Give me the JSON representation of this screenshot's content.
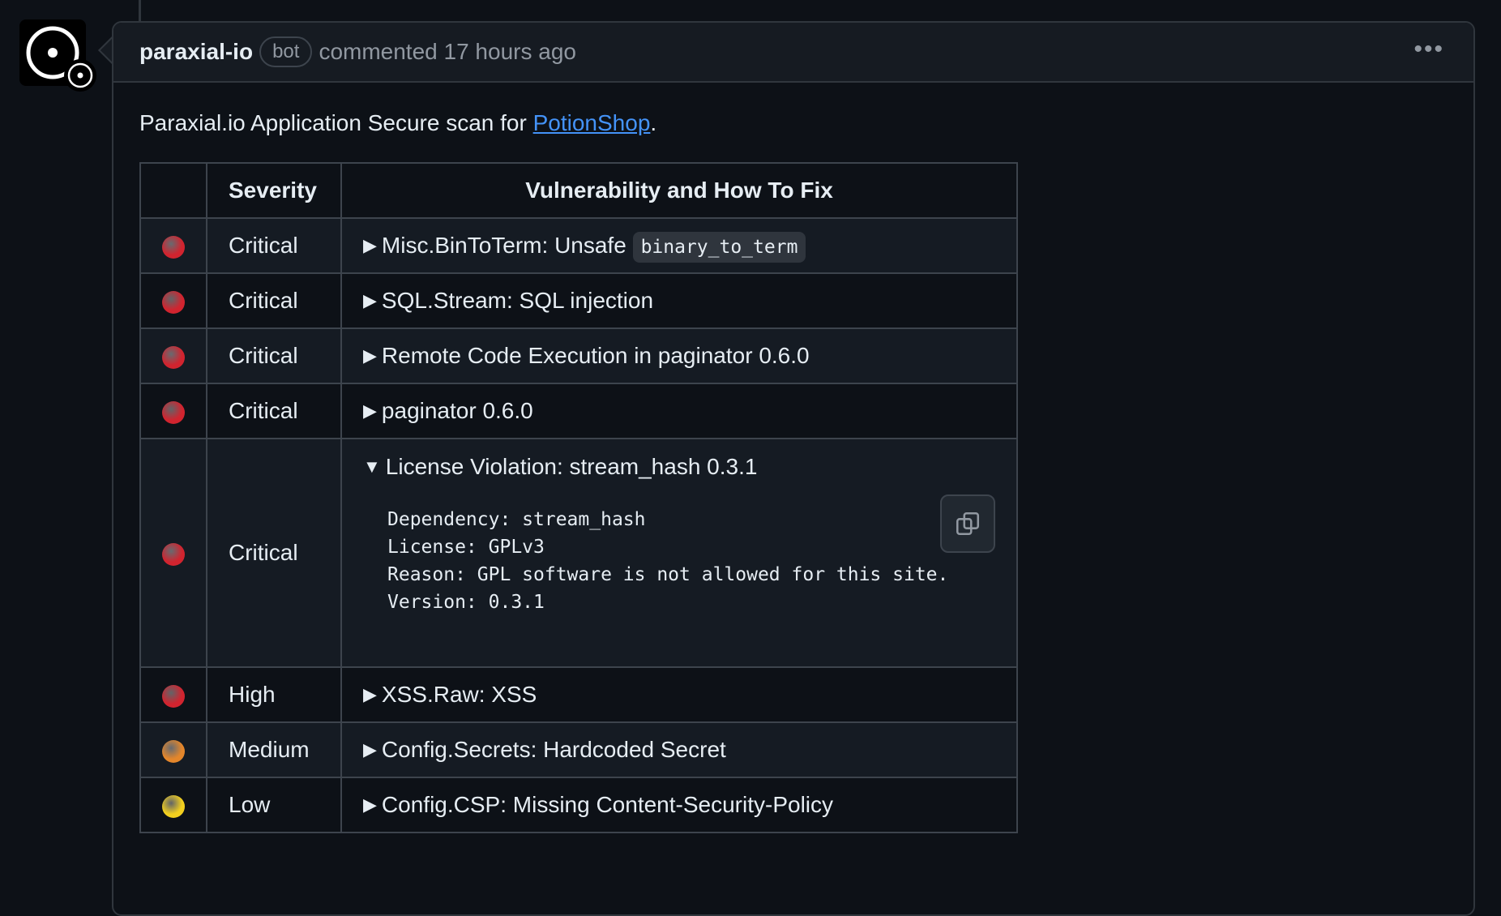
{
  "comment": {
    "author": "paraxial-io",
    "badge": "bot",
    "meta": "commented 17 hours ago",
    "menu_icon": "kebab-horizontal-icon"
  },
  "body": {
    "intro_prefix": "Paraxial.io Application Secure scan for ",
    "intro_link": "PotionShop",
    "intro_suffix": "."
  },
  "table": {
    "headers": [
      "",
      "Severity",
      "Vulnerability and How To Fix"
    ],
    "rows": [
      {
        "color": "#d1242f",
        "severity": "Critical",
        "title": "Misc.BinToTerm: Unsafe ",
        "code": "binary_to_term",
        "expanded": false
      },
      {
        "color": "#d1242f",
        "severity": "Critical",
        "title": "SQL.Stream: SQL injection",
        "expanded": false
      },
      {
        "color": "#d1242f",
        "severity": "Critical",
        "title": "Remote Code Execution in paginator 0.6.0",
        "expanded": false
      },
      {
        "color": "#d1242f",
        "severity": "Critical",
        "title": "paginator 0.6.0",
        "expanded": false
      },
      {
        "color": "#d1242f",
        "severity": "Critical",
        "title": "License Violation: stream_hash 0.3.1",
        "expanded": true,
        "details": [
          "Dependency: stream_hash",
          "License: GPLv3",
          "Reason: GPL software is not allowed for this site.",
          "Version: 0.3.1"
        ]
      },
      {
        "color": "#d1242f",
        "severity": "High",
        "title": "XSS.Raw: XSS",
        "expanded": false
      },
      {
        "color": "#e3862b",
        "severity": "Medium",
        "title": "Config.Secrets: Hardcoded Secret",
        "expanded": false
      },
      {
        "color": "#f2cf1f",
        "severity": "Low",
        "title": "Config.CSP: Missing Content-Security-Policy",
        "expanded": false
      }
    ]
  }
}
